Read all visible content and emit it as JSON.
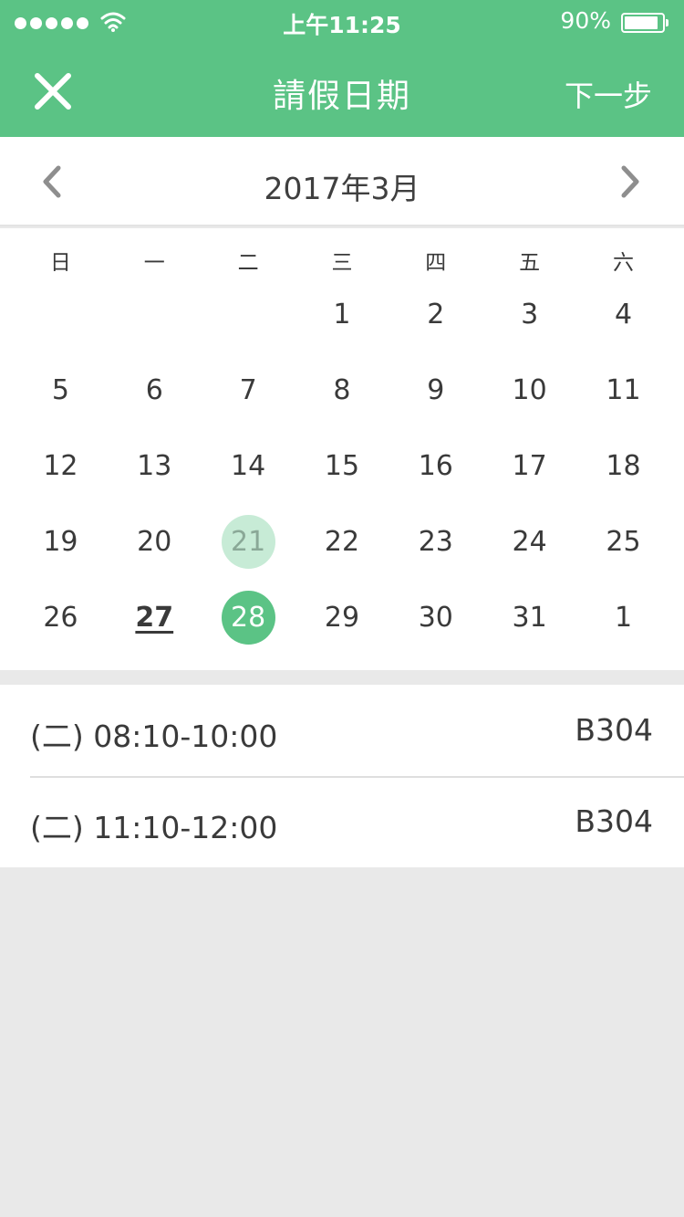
{
  "status_bar": {
    "time": "上午11:25",
    "battery_text": "90%",
    "battery_level": 0.9
  },
  "nav": {
    "title": "請假日期",
    "next_label": "下一步",
    "close_icon": "close-icon"
  },
  "calendar": {
    "month_label": "2017年3月",
    "weekdays": [
      "日",
      "一",
      "二",
      "三",
      "四",
      "五",
      "六"
    ],
    "days": [
      {
        "label": "",
        "state": "empty"
      },
      {
        "label": "",
        "state": "empty"
      },
      {
        "label": "",
        "state": "empty"
      },
      {
        "label": "1",
        "state": "normal"
      },
      {
        "label": "2",
        "state": "normal"
      },
      {
        "label": "3",
        "state": "normal"
      },
      {
        "label": "4",
        "state": "normal"
      },
      {
        "label": "5",
        "state": "normal"
      },
      {
        "label": "6",
        "state": "normal"
      },
      {
        "label": "7",
        "state": "normal"
      },
      {
        "label": "8",
        "state": "normal"
      },
      {
        "label": "9",
        "state": "normal"
      },
      {
        "label": "10",
        "state": "normal"
      },
      {
        "label": "11",
        "state": "normal"
      },
      {
        "label": "12",
        "state": "normal"
      },
      {
        "label": "13",
        "state": "normal"
      },
      {
        "label": "14",
        "state": "normal"
      },
      {
        "label": "15",
        "state": "normal"
      },
      {
        "label": "16",
        "state": "normal"
      },
      {
        "label": "17",
        "state": "normal"
      },
      {
        "label": "18",
        "state": "normal"
      },
      {
        "label": "19",
        "state": "normal"
      },
      {
        "label": "20",
        "state": "normal"
      },
      {
        "label": "21",
        "state": "light"
      },
      {
        "label": "22",
        "state": "normal"
      },
      {
        "label": "23",
        "state": "normal"
      },
      {
        "label": "24",
        "state": "normal"
      },
      {
        "label": "25",
        "state": "normal"
      },
      {
        "label": "26",
        "state": "normal"
      },
      {
        "label": "27",
        "state": "today"
      },
      {
        "label": "28",
        "state": "selected"
      },
      {
        "label": "29",
        "state": "normal"
      },
      {
        "label": "30",
        "state": "normal"
      },
      {
        "label": "31",
        "state": "normal"
      },
      {
        "label": "1",
        "state": "normal"
      }
    ]
  },
  "sessions": [
    {
      "time": "(二) 08:10-10:00",
      "room": "B304"
    },
    {
      "time": "(二) 11:10-12:00",
      "room": "B304"
    }
  ],
  "colors": {
    "accent": "#5bc385",
    "accent_light": "#c7ebd6",
    "background": "#e9e9e9"
  }
}
